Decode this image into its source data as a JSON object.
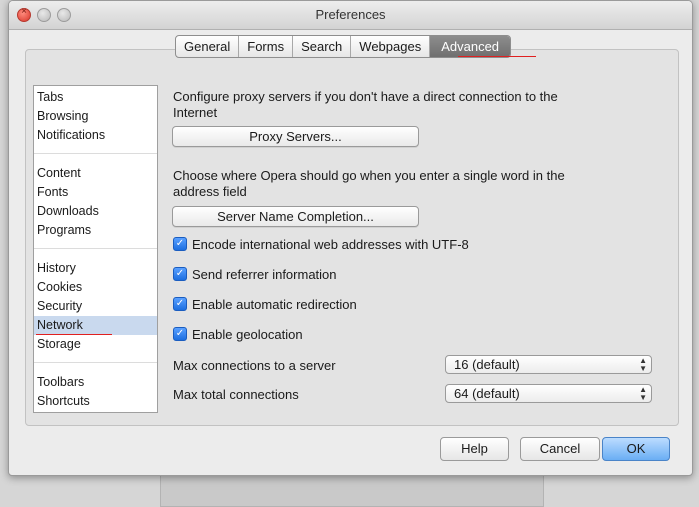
{
  "window": {
    "title": "Preferences"
  },
  "tabs": [
    "General",
    "Forms",
    "Search",
    "Webpages",
    "Advanced"
  ],
  "active_tab": "Advanced",
  "sidebar": {
    "groups": [
      [
        "Tabs",
        "Browsing",
        "Notifications"
      ],
      [
        "Content",
        "Fonts",
        "Downloads",
        "Programs"
      ],
      [
        "History",
        "Cookies",
        "Security",
        "Network",
        "Storage"
      ],
      [
        "Toolbars",
        "Shortcuts"
      ]
    ],
    "selected": "Network"
  },
  "network": {
    "proxy_text": "Configure proxy servers if you don't have a direct connection to the Internet",
    "proxy_button": "Proxy Servers...",
    "completion_text": "Choose where Opera should go when you enter a single word in the address field",
    "completion_button": "Server Name Completion...",
    "checkboxes": [
      {
        "label": "Encode international web addresses with UTF-8",
        "checked": true
      },
      {
        "label": "Send referrer information",
        "checked": true
      },
      {
        "label": "Enable automatic redirection",
        "checked": true
      },
      {
        "label": "Enable geolocation",
        "checked": true
      }
    ],
    "max_server_label": "Max connections to a server",
    "max_server_value": "16 (default)",
    "max_total_label": "Max total connections",
    "max_total_value": "64 (default)"
  },
  "footer": {
    "help": "Help",
    "cancel": "Cancel",
    "ok": "OK"
  },
  "colors": {
    "accent_red": "#e02020",
    "selection": "#c9d9ee",
    "ok_button": "#6aaef4"
  }
}
